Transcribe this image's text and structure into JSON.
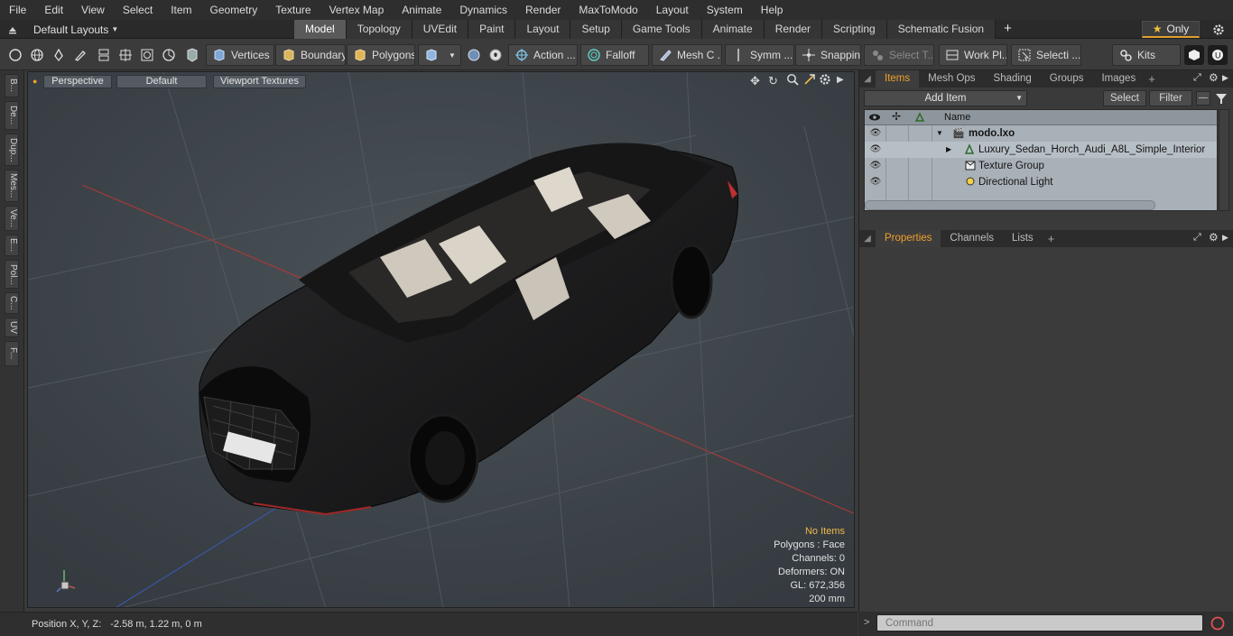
{
  "menu": [
    "File",
    "Edit",
    "View",
    "Select",
    "Item",
    "Geometry",
    "Texture",
    "Vertex Map",
    "Animate",
    "Dynamics",
    "Render",
    "MaxToModo",
    "Layout",
    "System",
    "Help"
  ],
  "layouts": {
    "label": "Default Layouts"
  },
  "tabs": [
    {
      "label": "Model",
      "active": true
    },
    {
      "label": "Topology"
    },
    {
      "label": "UVEdit"
    },
    {
      "label": "Paint"
    },
    {
      "label": "Layout"
    },
    {
      "label": "Setup"
    },
    {
      "label": "Game Tools"
    },
    {
      "label": "Animate"
    },
    {
      "label": "Render"
    },
    {
      "label": "Scripting"
    },
    {
      "label": "Schematic Fusion"
    }
  ],
  "only_label": "Only",
  "toolbar": {
    "vertices": "Vertices",
    "boundary": "Boundary",
    "polygons": "Polygons",
    "action": "Action ...",
    "falloff": "Falloff",
    "mesh": "Mesh C ...",
    "symm": "Symm ...",
    "snapping": "Snapping",
    "select_t": "Select T...",
    "work_pl": "Work Pl...",
    "selecti": "Selecti ...",
    "kits": "Kits"
  },
  "left_tabs": [
    "B...",
    "De...",
    "Dup...",
    "Mes...",
    "Ve...",
    "E...",
    "Pol...",
    "C...",
    "UV",
    "F..."
  ],
  "viewport": {
    "perspective": "Perspective",
    "default": "Default",
    "textures": "Viewport Textures",
    "info": {
      "no_items": "No Items",
      "polygons": "Polygons : Face",
      "channels": "Channels: 0",
      "deformers": "Deformers: ON",
      "gl": "GL: 672,356",
      "scale": "200 mm"
    }
  },
  "status": {
    "label": "Position X, Y, Z:",
    "value": "-2.58 m, 1.22 m, 0 m"
  },
  "items_panel": {
    "tabs": [
      "Items",
      "Mesh Ops",
      "Shading",
      "Groups",
      "Images"
    ],
    "add_item": "Add Item",
    "select": "Select",
    "filter": "Filter",
    "col_name": "Name",
    "tree": [
      {
        "label": "modo.lxo"
      },
      {
        "label": "Luxury_Sedan_Horch_Audi_A8L_Simple_Interior"
      },
      {
        "label": "Texture Group"
      },
      {
        "label": "Directional Light"
      }
    ]
  },
  "props_panel": {
    "tabs": [
      "Properties",
      "Channels",
      "Lists"
    ]
  },
  "command": {
    "placeholder": "Command"
  },
  "colors": {
    "accent": "#f0a02a",
    "viewport_bg": "#3e454b"
  }
}
